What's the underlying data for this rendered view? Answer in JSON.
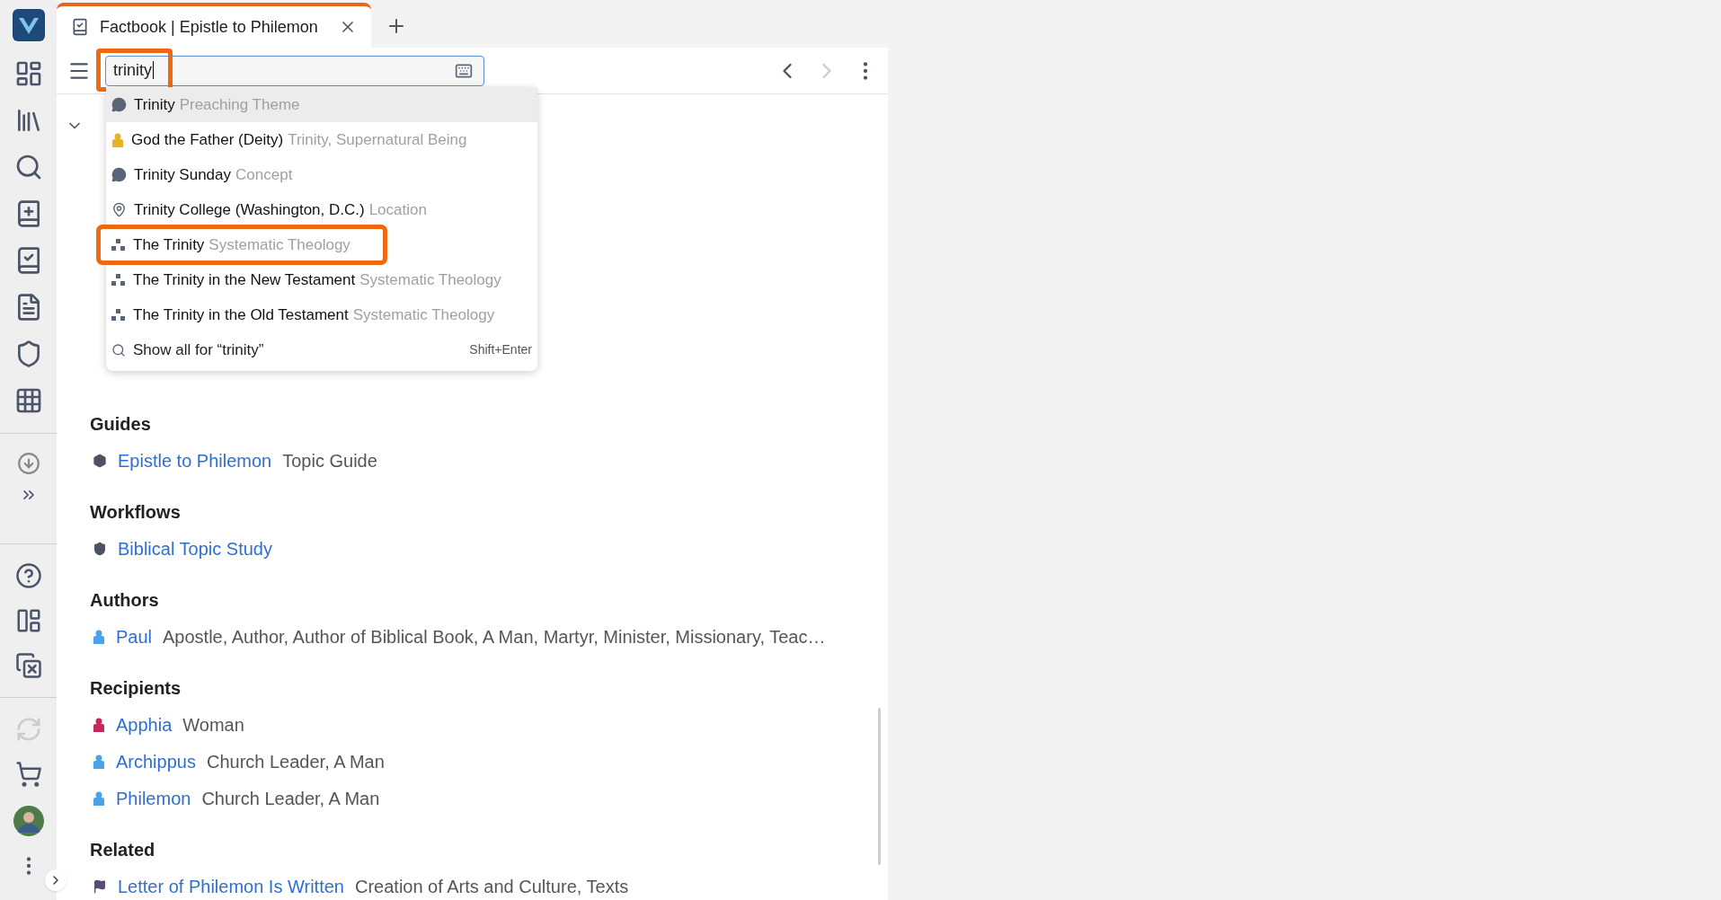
{
  "tab": {
    "title": "Factbook | Epistle to Philemon",
    "selected": true
  },
  "search": {
    "value": "trinity"
  },
  "suggestions": [
    {
      "kind": "theme",
      "title": "Trinity",
      "type": "Preaching Theme",
      "selected": true,
      "highlighted": false
    },
    {
      "kind": "deity",
      "title": "God the Father (Deity)",
      "type": "Trinity, Supernatural Being",
      "selected": false,
      "highlighted": false
    },
    {
      "kind": "theme",
      "title": "Trinity Sunday",
      "type": "Concept",
      "selected": false,
      "highlighted": false
    },
    {
      "kind": "location",
      "title": "Trinity College (Washington, D.C.)",
      "type": "Location",
      "selected": false,
      "highlighted": false
    },
    {
      "kind": "theology",
      "title": "The Trinity",
      "type": "Systematic Theology",
      "selected": false,
      "highlighted": true
    },
    {
      "kind": "theology",
      "title": "The Trinity in the New Testament",
      "type": "Systematic Theology",
      "selected": false,
      "highlighted": false
    },
    {
      "kind": "theology",
      "title": "The Trinity in the Old Testament",
      "type": "Systematic Theology",
      "selected": false,
      "highlighted": false
    }
  ],
  "show_all": {
    "label": "Show all for “trinity”",
    "shortcut": "Shift+Enter"
  },
  "section": {
    "expanded": true
  },
  "groups": [
    {
      "heading": "Guides",
      "items": [
        {
          "kind": "guide",
          "link": "Epistle to Philemon",
          "detail": "Topic Guide"
        }
      ]
    },
    {
      "heading": "Workflows",
      "items": [
        {
          "kind": "workflow",
          "link": "Biblical Topic Study"
        }
      ]
    },
    {
      "heading": "Authors",
      "items": [
        {
          "kind": "man",
          "link": "Paul",
          "detail": "Apostle, Author, Author of Biblical Book, A Man, Martyr, Minister, Missionary, Teac…"
        }
      ]
    },
    {
      "heading": "Recipients",
      "items": [
        {
          "kind": "woman",
          "link": "Apphia",
          "detail": "Woman"
        },
        {
          "kind": "man",
          "link": "Archippus",
          "detail": "Church Leader, A Man"
        },
        {
          "kind": "man",
          "link": "Philemon",
          "detail": "Church Leader, A Man"
        }
      ]
    },
    {
      "heading": "Related",
      "items": [
        {
          "kind": "event",
          "link": "Letter of Philemon Is Written",
          "detail": "Creation of Arts and Culture, Texts"
        }
      ]
    }
  ]
}
